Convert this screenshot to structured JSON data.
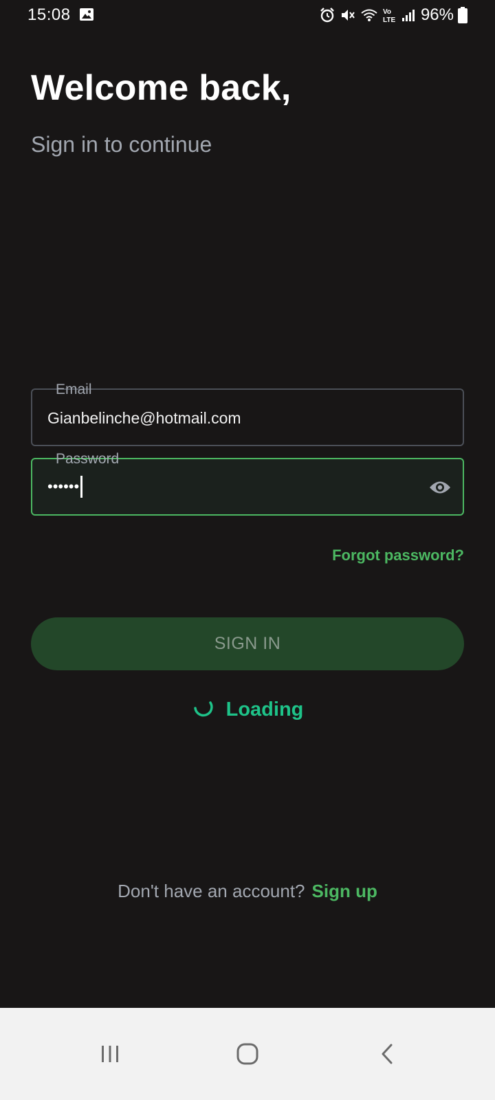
{
  "status_bar": {
    "time": "15:08",
    "battery_percent": "96%",
    "icons": [
      "gallery-icon",
      "alarm-icon",
      "mute-icon",
      "wifi-icon",
      "volte-icon",
      "signal-icon",
      "battery-icon"
    ]
  },
  "header": {
    "title": "Welcome back,",
    "subtitle": "Sign in to continue"
  },
  "form": {
    "email": {
      "label": "Email",
      "value": "Gianbelinche@hotmail.com"
    },
    "password": {
      "label": "Password",
      "masked_value": "••••••",
      "visibility_icon": "eye-icon"
    },
    "forgot_password": "Forgot password?",
    "sign_in_label": "SIGN IN",
    "loading_text": "Loading"
  },
  "footer": {
    "prompt": "Don't have an account?",
    "signup_label": "Sign up"
  },
  "nav_bar": {
    "buttons": [
      "recents-icon",
      "home-icon",
      "back-icon"
    ]
  },
  "colors": {
    "background": "#181616",
    "accent_green": "#4cb862",
    "loading_teal": "#1ec389",
    "button_fill": "#234729",
    "muted_text": "#a2a7b0",
    "nav_background": "#f2f2f2"
  }
}
